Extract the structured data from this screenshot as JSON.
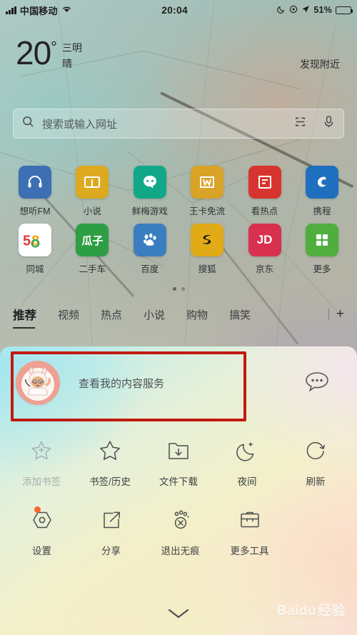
{
  "status_bar": {
    "carrier": "中国移动",
    "signal_icon": "signal-bars-icon",
    "wifi_icon": "wifi-icon",
    "time": "20:04",
    "moon_icon": "moon-icon",
    "rotation_lock_icon": "rotation-lock-icon",
    "location_icon": "location-arrow-icon",
    "battery_percent": "51%",
    "battery_icon": "battery-icon"
  },
  "weather": {
    "temperature": "20",
    "degree_symbol": "°",
    "city": "三明",
    "condition": "晴",
    "nearby_label": "发现附近"
  },
  "search": {
    "placeholder": "搜索或输入网址",
    "search_icon": "search-icon",
    "scan_icon": "scan-code-icon",
    "voice_icon": "microphone-icon"
  },
  "shortcuts": {
    "rows": [
      [
        {
          "label": "想听FM",
          "icon": "headphones-icon",
          "color": "#3c6fb4"
        },
        {
          "label": "小说",
          "icon": "book-icon",
          "color": "#dda920"
        },
        {
          "label": "鲜梅游戏",
          "icon": "game-face-icon",
          "color": "#11a888"
        },
        {
          "label": "王卡免流",
          "icon": "w-letter-icon",
          "color": "#d9a327"
        },
        {
          "label": "看热点",
          "icon": "news-list-icon",
          "color": "#d8342f"
        },
        {
          "label": "携程",
          "icon": "ctrip-icon",
          "color": "#1f6fbf"
        }
      ],
      [
        {
          "label": "同城",
          "icon": "58-logo-icon",
          "color": "#ffffff"
        },
        {
          "label": "二手车",
          "icon": "guazi-icon",
          "color": "#2e9e45"
        },
        {
          "label": "百度",
          "icon": "paw-icon",
          "color": "#3a7ec0"
        },
        {
          "label": "搜狐",
          "icon": "sohu-icon",
          "color": "#e0ab16"
        },
        {
          "label": "京东",
          "icon": "jd-logo-icon",
          "color": "#d8304f"
        },
        {
          "label": "更多",
          "icon": "grid-more-icon",
          "color": "#4fae3d"
        }
      ]
    ],
    "page_dots": 2,
    "active_dot": 1
  },
  "channel_tabs": {
    "items": [
      "推荐",
      "视频",
      "热点",
      "小说",
      "购物",
      "搞笑"
    ],
    "active_index": 0,
    "add_label": "+",
    "add_icon": "plus-icon"
  },
  "panel": {
    "profile": {
      "avatar_icon": "rabbit-avatar",
      "text": "查看我的内容服务",
      "feedback_icon": "chat-bubble-icon",
      "highlight_color": "#c01a10"
    },
    "menu_rows": [
      [
        {
          "label": "添加书签",
          "icon": "star-plus-icon",
          "disabled": true
        },
        {
          "label": "书签/历史",
          "icon": "star-icon",
          "disabled": false
        },
        {
          "label": "文件下载",
          "icon": "download-folder-icon",
          "disabled": false
        },
        {
          "label": "夜间",
          "icon": "moon-icon",
          "disabled": false
        },
        {
          "label": "刷新",
          "icon": "refresh-icon",
          "disabled": false
        }
      ],
      [
        {
          "label": "设置",
          "icon": "settings-gear-icon",
          "disabled": false,
          "badge": true
        },
        {
          "label": "分享",
          "icon": "share-icon",
          "disabled": false
        },
        {
          "label": "退出无痕",
          "icon": "incognito-paw-icon",
          "disabled": false
        },
        {
          "label": "更多工具",
          "icon": "toolbox-icon",
          "disabled": false
        }
      ]
    ],
    "collapse_icon": "chevron-down-icon"
  },
  "watermark": {
    "brand": "Baidu",
    "suffix": "经验",
    "url": "jingyan.baidu.com"
  }
}
